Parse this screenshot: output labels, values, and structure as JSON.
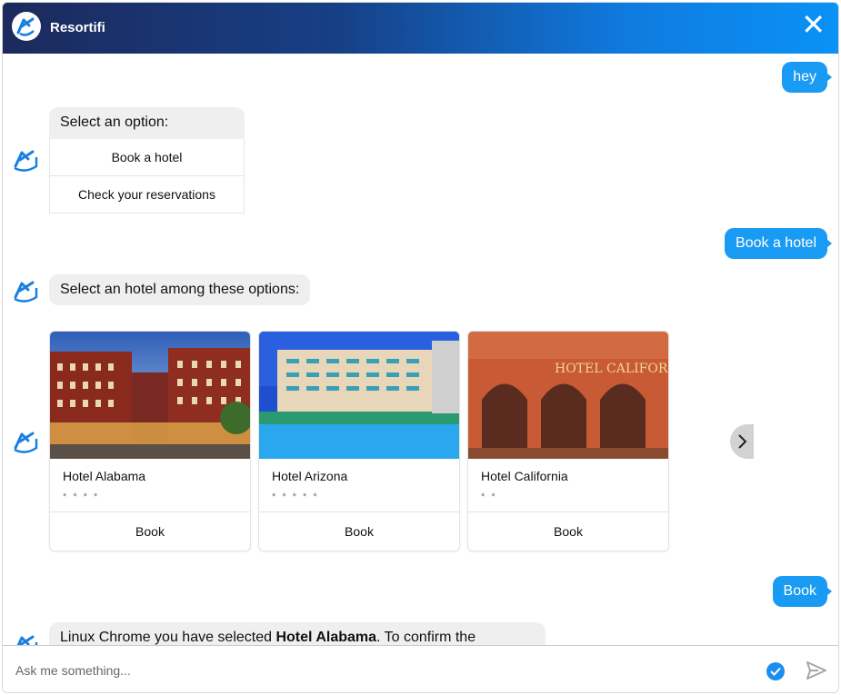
{
  "header": {
    "title": "Resortifi",
    "close_icon": "close-icon",
    "brand_colors": [
      "#1c2a5c",
      "#0a92f5"
    ]
  },
  "messages": {
    "user_hey": "hey",
    "bot_select_option": "Select an option:",
    "options": [
      "Book a hotel",
      "Check your reservations"
    ],
    "user_book_hotel": "Book a hotel",
    "bot_select_hotel": "Select an hotel among these options:",
    "user_book": "Book",
    "bot_confirm_prefix": "Linux Chrome you have selected ",
    "bot_confirm_hotel": "Hotel Alabama",
    "bot_confirm_suffix": ". To confirm the"
  },
  "hotels": [
    {
      "name": "Hotel Alabama",
      "stars": "* * * *",
      "button": "Book"
    },
    {
      "name": "Hotel Arizona",
      "stars": "* * * * *",
      "button": "Book"
    },
    {
      "name": "Hotel California",
      "stars": "* *",
      "button": "Book",
      "sign": "HOTEL CALIFORNIA"
    }
  ],
  "carousel": {
    "next_icon": "chevron-right-icon"
  },
  "composer": {
    "placeholder": "Ask me something...",
    "check_icon": "check-circle-icon",
    "send_icon": "send-icon"
  },
  "colors": {
    "user_bubble": "#1a9bf3",
    "bot_bubble": "#efefef",
    "accent": "#1a8ff0"
  }
}
